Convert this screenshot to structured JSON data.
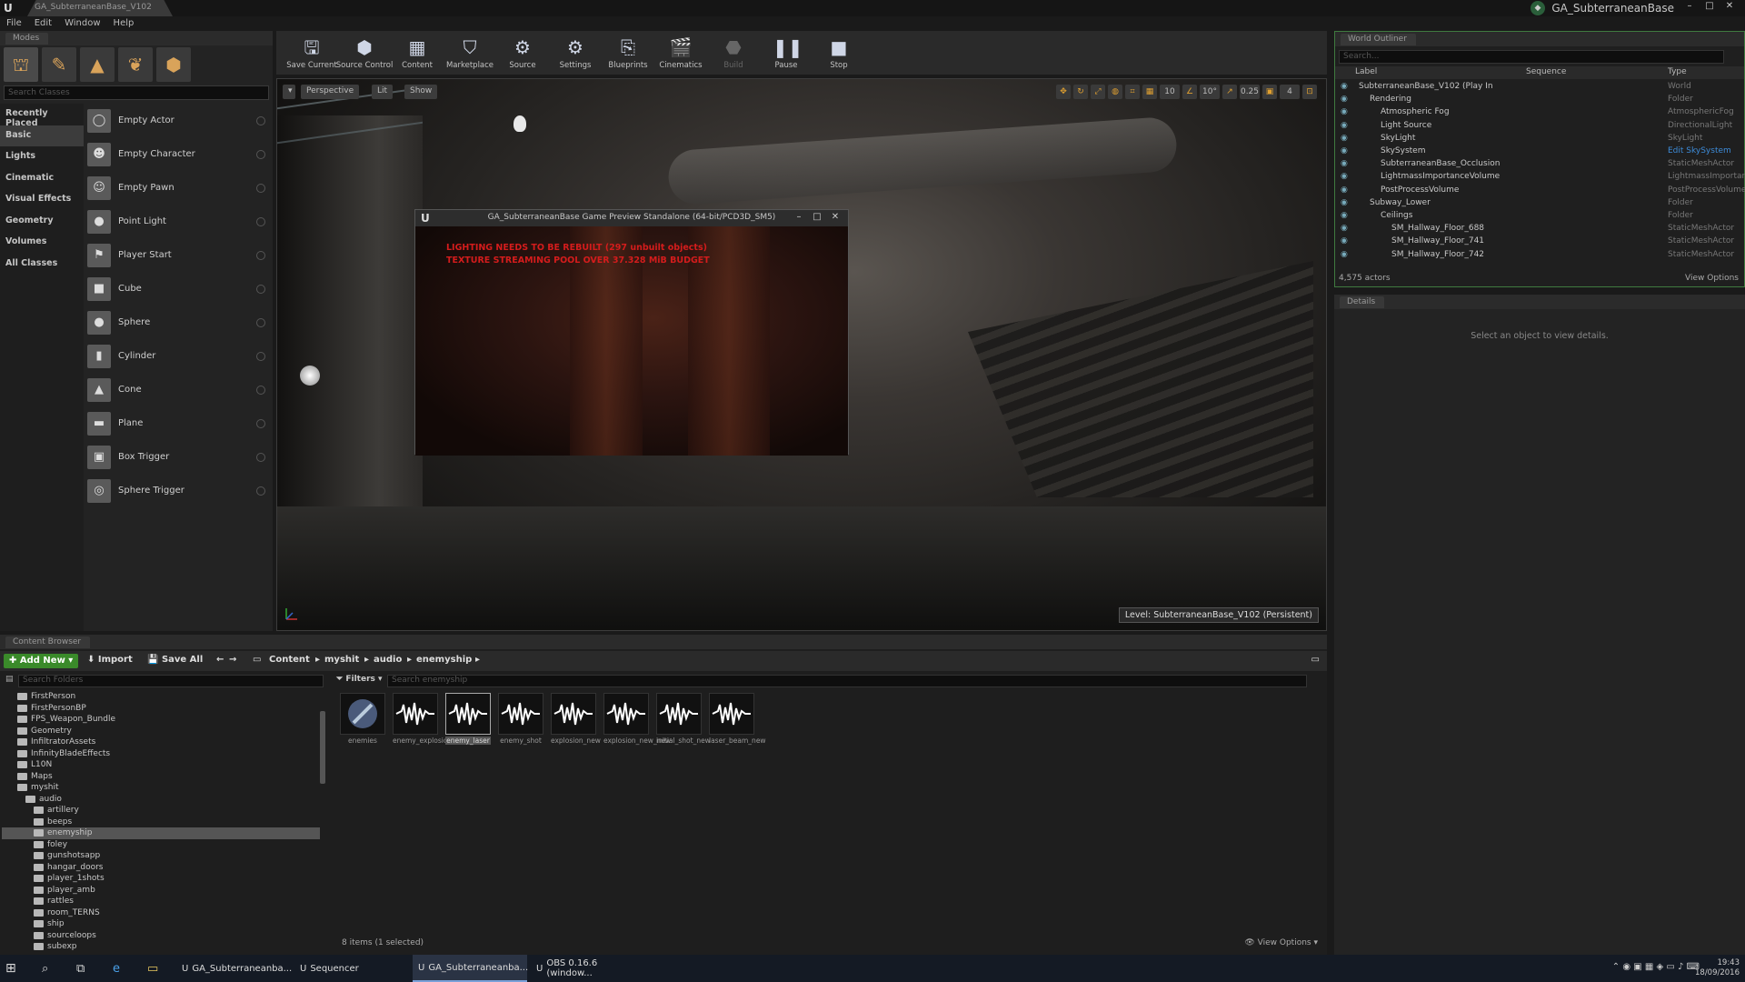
{
  "titlebar": {
    "tab_title": "GA_SubterraneanBase_V102",
    "project_name": "GA_SubterraneanBase",
    "minimize": "–",
    "maximize": "□",
    "close": "✕"
  },
  "menu": [
    "File",
    "Edit",
    "Window",
    "Help"
  ],
  "modes": {
    "tab_label": "Modes",
    "search_placeholder": "Search Classes",
    "categories": [
      "Recently Placed",
      "Basic",
      "Lights",
      "Cinematic",
      "Visual Effects",
      "Geometry",
      "Volumes",
      "All Classes"
    ],
    "active_category": "Basic",
    "items": [
      "Empty Actor",
      "Empty Character",
      "Empty Pawn",
      "Point Light",
      "Player Start",
      "Cube",
      "Sphere",
      "Cylinder",
      "Cone",
      "Plane",
      "Box Trigger",
      "Sphere Trigger"
    ]
  },
  "toolbar": {
    "buttons": [
      {
        "label": "Save Current",
        "icon": "save-icon"
      },
      {
        "label": "Source Control",
        "icon": "source-control-icon"
      },
      {
        "label": "Content",
        "icon": "content-icon"
      },
      {
        "label": "Marketplace",
        "icon": "marketplace-icon"
      },
      {
        "label": "Source",
        "icon": "source-icon"
      },
      {
        "label": "Settings",
        "icon": "settings-icon"
      },
      {
        "label": "Blueprints",
        "icon": "blueprints-icon"
      },
      {
        "label": "Cinematics",
        "icon": "cinematics-icon"
      },
      {
        "label": "Build",
        "icon": "build-icon"
      },
      {
        "label": "Pause",
        "icon": "pause-icon"
      },
      {
        "label": "Stop",
        "icon": "stop-icon"
      }
    ]
  },
  "viewport": {
    "perspective": "Perspective",
    "lit": "Lit",
    "show": "Show",
    "grid_value": "10",
    "angle_value": "10°",
    "scale_value": "0.25",
    "camera_speed": "4",
    "level_label": "Level: SubterraneanBase_V102 (Persistent)"
  },
  "pie_window": {
    "title": "GA_SubterraneanBase Game Preview Standalone (64-bit/PCD3D_SM5)",
    "warning_1": "LIGHTING NEEDS TO BE REBUILT (297 unbuilt objects)",
    "warning_2": "TEXTURE STREAMING POOL OVER 37.328 MiB BUDGET"
  },
  "outliner": {
    "tab_label": "World Outliner",
    "search_placeholder": "Search...",
    "columns": {
      "label": "Label",
      "sequence": "Sequence",
      "type": "Type"
    },
    "rows": [
      {
        "label": "SubterraneanBase_V102 (Play In",
        "type": "World",
        "indent": 0
      },
      {
        "label": "Rendering",
        "type": "Folder",
        "indent": 1
      },
      {
        "label": "Atmospheric Fog",
        "type": "AtmosphericFog",
        "indent": 2
      },
      {
        "label": "Light Source",
        "type": "DirectionalLight",
        "indent": 2
      },
      {
        "label": "SkyLight",
        "type": "SkyLight",
        "indent": 2
      },
      {
        "label": "SkySystem",
        "type": "Edit SkySystem",
        "indent": 2,
        "link": true
      },
      {
        "label": "SubterraneanBase_Occlusion",
        "type": "StaticMeshActor",
        "indent": 2
      },
      {
        "label": "LightmassImportanceVolume",
        "type": "LightmassImportance",
        "indent": 2
      },
      {
        "label": "PostProcessVolume",
        "type": "PostProcessVolume",
        "indent": 2
      },
      {
        "label": "Subway_Lower",
        "type": "Folder",
        "indent": 1
      },
      {
        "label": "Ceilings",
        "type": "Folder",
        "indent": 2
      },
      {
        "label": "SM_Hallway_Floor_688",
        "type": "StaticMeshActor",
        "indent": 3
      },
      {
        "label": "SM_Hallway_Floor_741",
        "type": "StaticMeshActor",
        "indent": 3
      },
      {
        "label": "SM_Hallway_Floor_742",
        "type": "StaticMeshActor",
        "indent": 3
      }
    ],
    "actor_count": "4,575 actors",
    "view_options": "View Options"
  },
  "details": {
    "tab_label": "Details",
    "empty_text": "Select an object to view details."
  },
  "content_browser": {
    "tab_label": "Content Browser",
    "add_new": "Add New",
    "import": "Import",
    "save_all": "Save All",
    "breadcrumb": [
      "Content",
      "myshit",
      "audio",
      "enemyship"
    ],
    "folder_search_placeholder": "Search Folders",
    "filters": "Filters",
    "asset_search_placeholder": "Search enemyship",
    "folders": [
      {
        "name": "FirstPerson",
        "indent": 1
      },
      {
        "name": "FirstPersonBP",
        "indent": 1
      },
      {
        "name": "FPS_Weapon_Bundle",
        "indent": 1
      },
      {
        "name": "Geometry",
        "indent": 1
      },
      {
        "name": "InfiltratorAssets",
        "indent": 1
      },
      {
        "name": "InfinityBladeEffects",
        "indent": 1
      },
      {
        "name": "L10N",
        "indent": 1
      },
      {
        "name": "Maps",
        "indent": 1
      },
      {
        "name": "myshit",
        "indent": 1
      },
      {
        "name": "audio",
        "indent": 2
      },
      {
        "name": "artillery",
        "indent": 3
      },
      {
        "name": "beeps",
        "indent": 3
      },
      {
        "name": "enemyship",
        "indent": 3,
        "selected": true
      },
      {
        "name": "foley",
        "indent": 3
      },
      {
        "name": "gunshotsapp",
        "indent": 3
      },
      {
        "name": "hangar_doors",
        "indent": 3
      },
      {
        "name": "player_1shots",
        "indent": 3
      },
      {
        "name": "player_amb",
        "indent": 3
      },
      {
        "name": "rattles",
        "indent": 3
      },
      {
        "name": "room_TERNS",
        "indent": 3
      },
      {
        "name": "ship",
        "indent": 3
      },
      {
        "name": "sourceloops",
        "indent": 3
      },
      {
        "name": "subexp",
        "indent": 3
      }
    ],
    "assets": [
      {
        "name": "enemies",
        "kind": "cue"
      },
      {
        "name": "enemy_explosion",
        "kind": "wave"
      },
      {
        "name": "enemy_laser",
        "kind": "wave",
        "selected": true
      },
      {
        "name": "enemy_shot",
        "kind": "wave"
      },
      {
        "name": "explosion_new",
        "kind": "wave"
      },
      {
        "name": "explosion_new_new",
        "kind": "wave"
      },
      {
        "name": "initial_shot_new",
        "kind": "wave"
      },
      {
        "name": "laser_beam_new",
        "kind": "wave"
      }
    ],
    "status": "8 items (1 selected)",
    "view_options": "View Options"
  },
  "taskbar": {
    "items": [
      {
        "label": "GA_Subterraneanba...",
        "active": false
      },
      {
        "label": "Sequencer",
        "active": false
      },
      {
        "label": "GA_Subterraneanba...",
        "active": true
      },
      {
        "label": "OBS 0.16.6 (window...",
        "active": false
      }
    ],
    "time": "19:43",
    "date": "18/09/2016"
  }
}
